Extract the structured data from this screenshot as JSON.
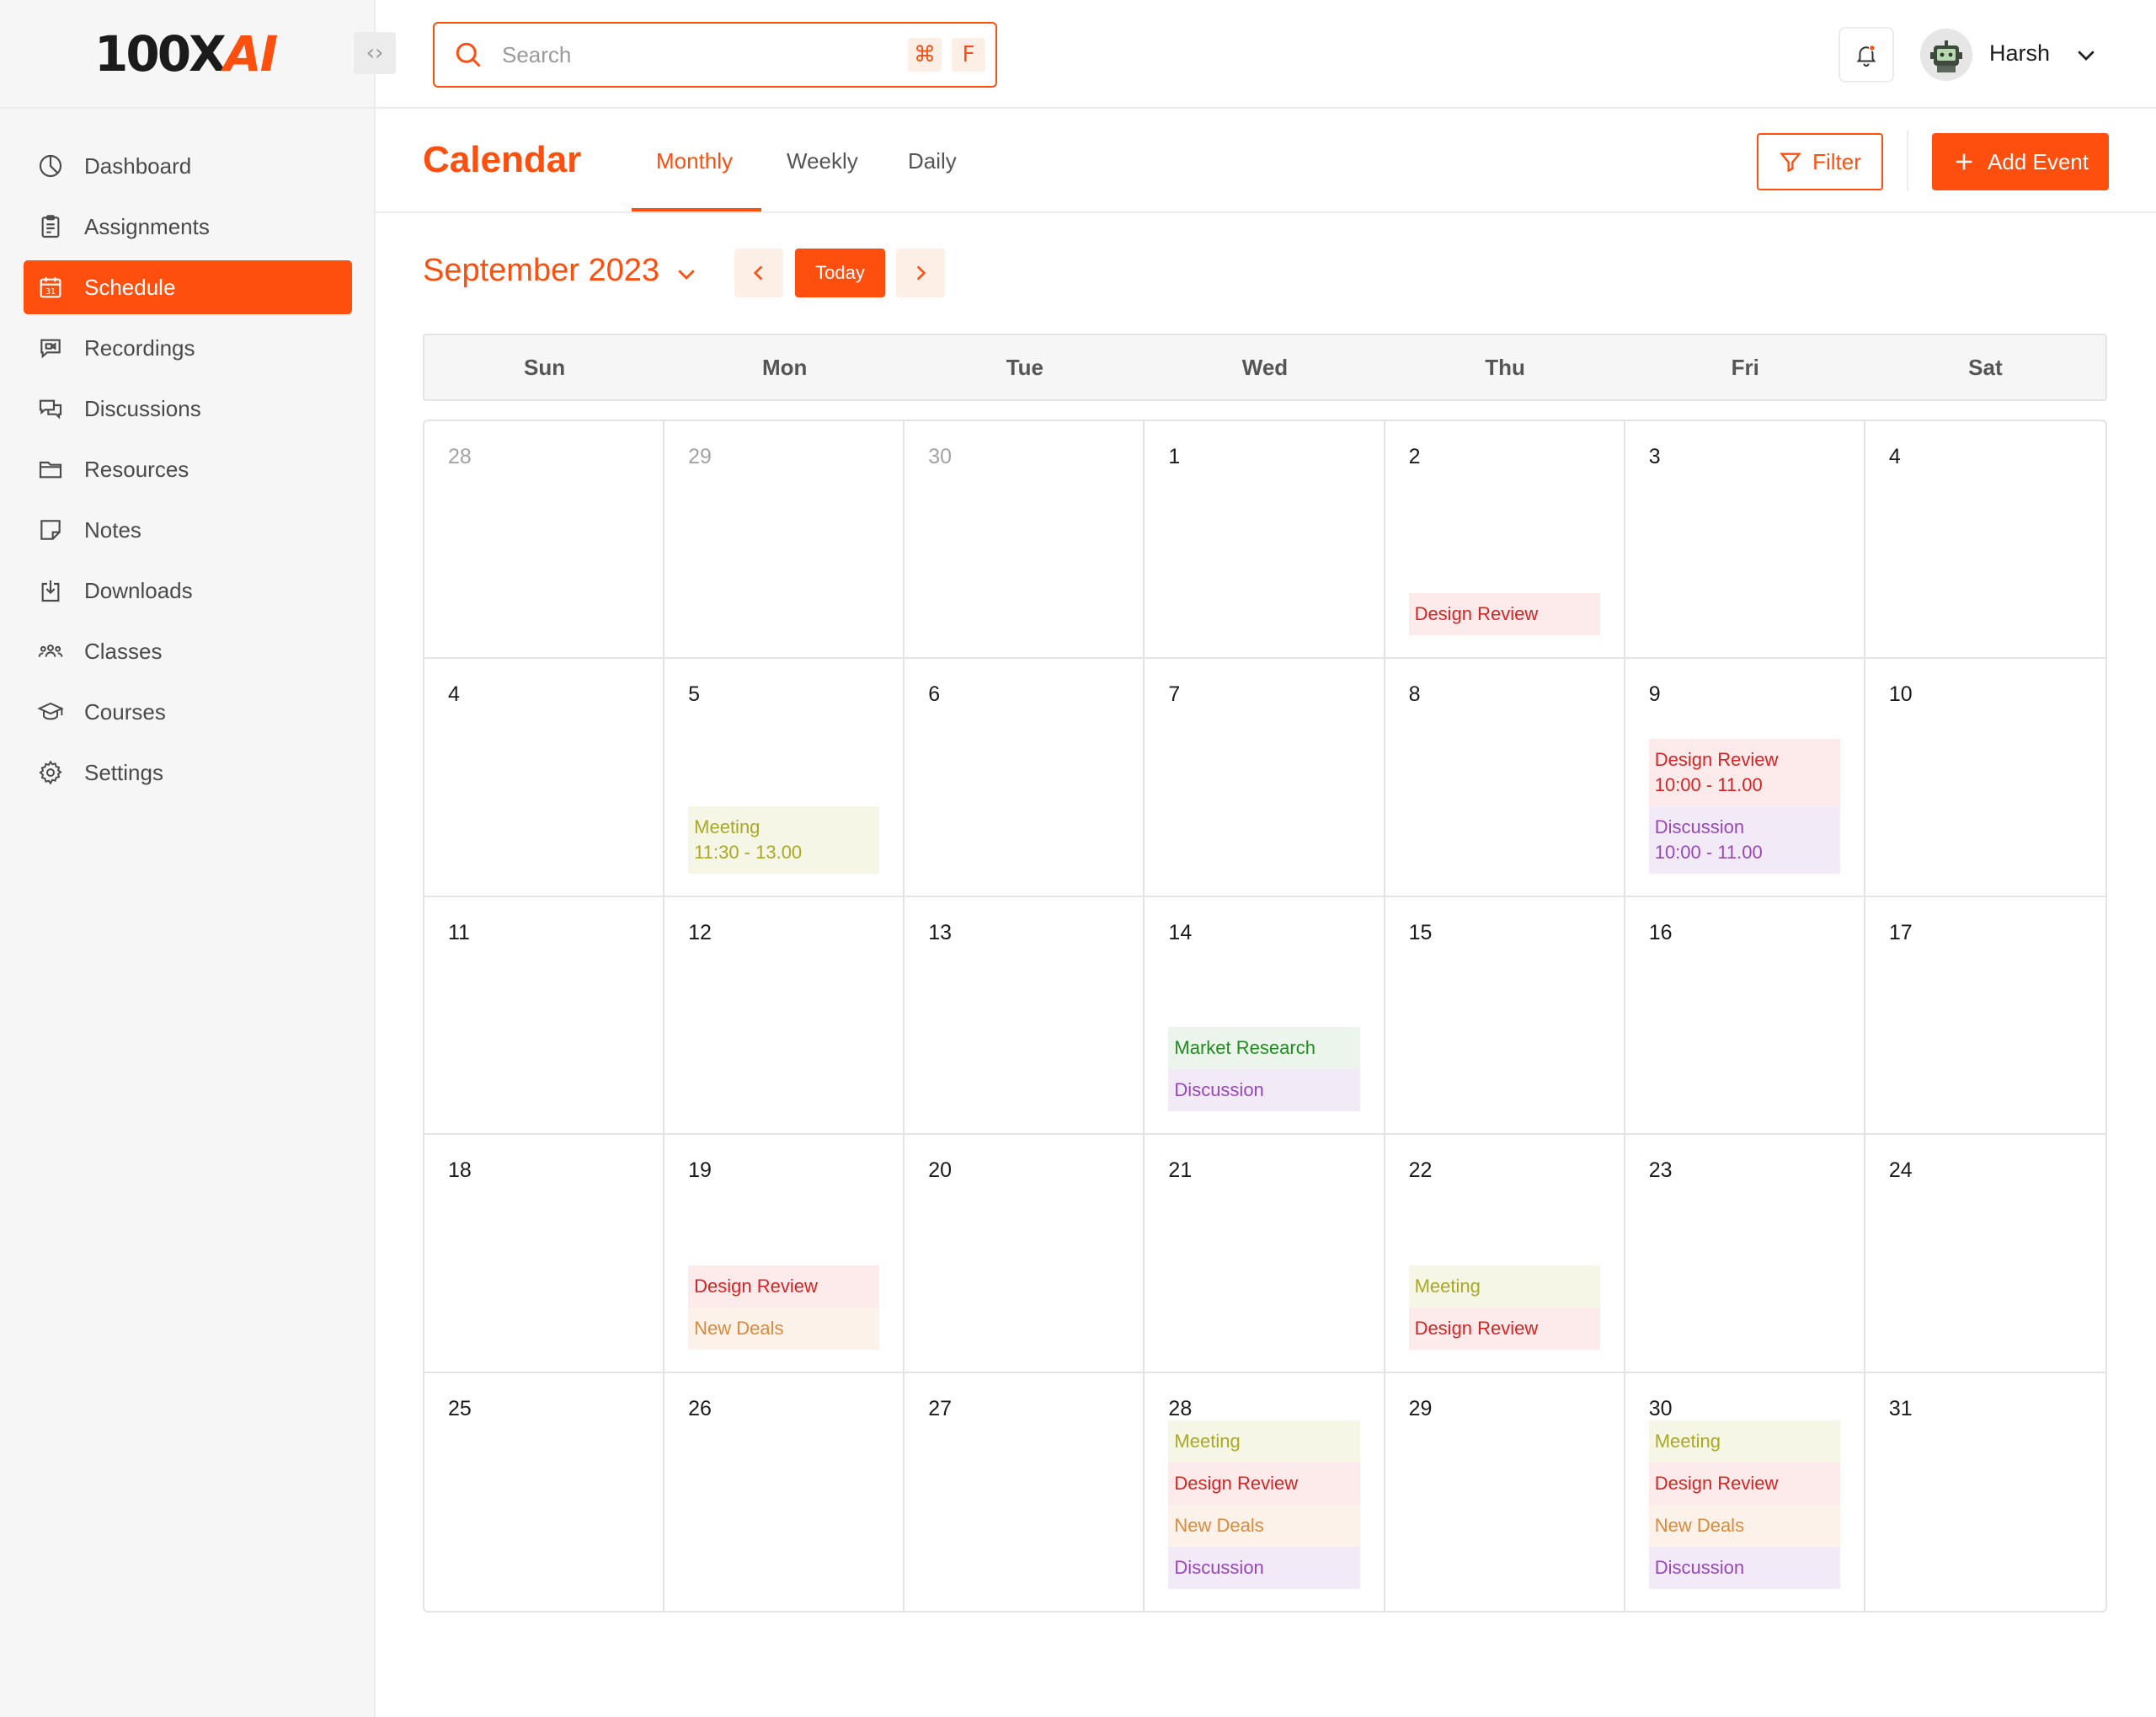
{
  "brand": {
    "logo_main": "100X",
    "logo_accent": "AI"
  },
  "sidebar": {
    "collapse_glyph": "‹›",
    "items": [
      {
        "label": "Dashboard",
        "icon": "dashboard-icon",
        "active": false
      },
      {
        "label": "Assignments",
        "icon": "clipboard-icon",
        "active": false
      },
      {
        "label": "Schedule",
        "icon": "calendar-icon",
        "active": true
      },
      {
        "label": "Recordings",
        "icon": "recording-icon",
        "active": false
      },
      {
        "label": "Discussions",
        "icon": "chat-icon",
        "active": false
      },
      {
        "label": "Resources",
        "icon": "folder-icon",
        "active": false
      },
      {
        "label": "Notes",
        "icon": "note-icon",
        "active": false
      },
      {
        "label": "Downloads",
        "icon": "download-icon",
        "active": false
      },
      {
        "label": "Classes",
        "icon": "users-icon",
        "active": false
      },
      {
        "label": "Courses",
        "icon": "graduation-cap-icon",
        "active": false
      },
      {
        "label": "Settings",
        "icon": "gear-icon",
        "active": false
      }
    ]
  },
  "topbar": {
    "search_placeholder": "Search",
    "shortcut_mod": "⌘",
    "shortcut_key": "F",
    "user_name": "Harsh"
  },
  "calendar": {
    "title": "Calendar",
    "views": [
      "Monthly",
      "Weekly",
      "Daily"
    ],
    "active_view": "Monthly",
    "filter_label": "Filter",
    "add_event_label": "Add Event",
    "month_label": "September 2023",
    "today_label": "Today",
    "weekdays": [
      "Sun",
      "Mon",
      "Tue",
      "Wed",
      "Thu",
      "Fri",
      "Sat"
    ],
    "days": [
      {
        "num": "28",
        "muted": true,
        "events": []
      },
      {
        "num": "29",
        "muted": true,
        "events": []
      },
      {
        "num": "30",
        "muted": true,
        "events": []
      },
      {
        "num": "1",
        "events": []
      },
      {
        "num": "2",
        "events": [
          {
            "title": "Design Review",
            "type": "design"
          }
        ]
      },
      {
        "num": "3",
        "events": []
      },
      {
        "num": "4",
        "events": []
      },
      {
        "num": "4",
        "events": []
      },
      {
        "num": "5",
        "events": [
          {
            "title": "Meeting",
            "time": "11:30 - 13.00",
            "type": "meeting"
          }
        ]
      },
      {
        "num": "6",
        "events": []
      },
      {
        "num": "7",
        "events": []
      },
      {
        "num": "8",
        "events": []
      },
      {
        "num": "9",
        "events": [
          {
            "title": "Design Review",
            "time": "10:00 - 11.00",
            "type": "design"
          },
          {
            "title": "Discussion",
            "time": "10:00 - 11.00",
            "type": "discussion"
          }
        ]
      },
      {
        "num": "10",
        "events": []
      },
      {
        "num": "11",
        "events": []
      },
      {
        "num": "12",
        "events": []
      },
      {
        "num": "13",
        "events": []
      },
      {
        "num": "14",
        "events": [
          {
            "title": "Market Research",
            "type": "market"
          },
          {
            "title": "Discussion",
            "type": "discussion"
          }
        ]
      },
      {
        "num": "15",
        "events": []
      },
      {
        "num": "16",
        "events": []
      },
      {
        "num": "17",
        "events": []
      },
      {
        "num": "18",
        "events": []
      },
      {
        "num": "19",
        "events": [
          {
            "title": "Design Review",
            "type": "design"
          },
          {
            "title": "New Deals",
            "type": "deals"
          }
        ]
      },
      {
        "num": "20",
        "events": []
      },
      {
        "num": "21",
        "events": []
      },
      {
        "num": "22",
        "events": [
          {
            "title": "Meeting",
            "type": "meeting"
          },
          {
            "title": "Design Review",
            "type": "design"
          }
        ]
      },
      {
        "num": "23",
        "events": []
      },
      {
        "num": "24",
        "events": []
      },
      {
        "num": "25",
        "events": []
      },
      {
        "num": "26",
        "events": []
      },
      {
        "num": "27",
        "events": []
      },
      {
        "num": "28",
        "events": [
          {
            "title": "Meeting",
            "type": "meeting"
          },
          {
            "title": "Design Review",
            "type": "design"
          },
          {
            "title": "New Deals",
            "type": "deals"
          },
          {
            "title": "Discussion",
            "type": "discussion"
          }
        ]
      },
      {
        "num": "29",
        "events": []
      },
      {
        "num": "30",
        "events": [
          {
            "title": "Meeting",
            "type": "meeting"
          },
          {
            "title": "Design Review",
            "type": "design"
          },
          {
            "title": "New Deals",
            "type": "deals"
          },
          {
            "title": "Discussion",
            "type": "discussion"
          }
        ]
      },
      {
        "num": "31",
        "events": []
      }
    ]
  },
  "colors": {
    "accent": "#ff4f0f",
    "design_review": "#d42525",
    "meeting": "#a9a923",
    "discussion": "#9748b8",
    "market_research": "#1f8c1f",
    "new_deals": "#d98a3a"
  }
}
